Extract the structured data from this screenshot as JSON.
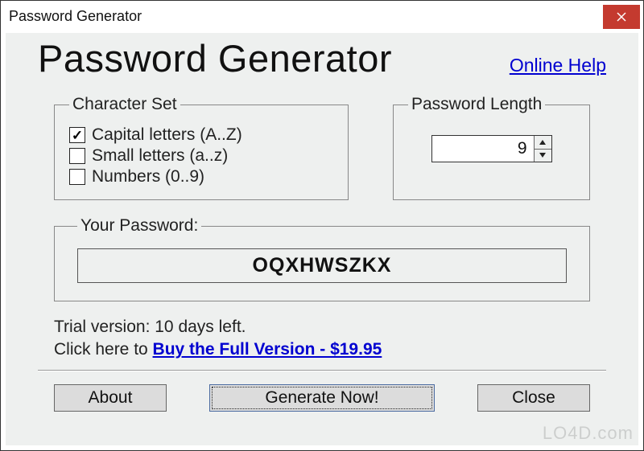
{
  "window": {
    "title": "Password Generator"
  },
  "header": {
    "big_title": "Password Generator",
    "online_help": "Online Help"
  },
  "charset": {
    "legend": "Character Set",
    "options": [
      {
        "label": "Capital letters (A..Z)",
        "checked": true
      },
      {
        "label": "Small letters (a..z)",
        "checked": false
      },
      {
        "label": "Numbers (0..9)",
        "checked": false
      }
    ]
  },
  "length": {
    "legend": "Password Length",
    "value": "9"
  },
  "output": {
    "legend": "Your Password:",
    "value": "OQXHWSZKX"
  },
  "trial": {
    "line1": "Trial version: 10 days left.",
    "line2_prefix": "Click here to ",
    "buy_link": "Buy the Full Version - $19.95"
  },
  "buttons": {
    "about": "About",
    "generate": "Generate Now!",
    "close": "Close"
  },
  "watermark": "LO4D.com"
}
